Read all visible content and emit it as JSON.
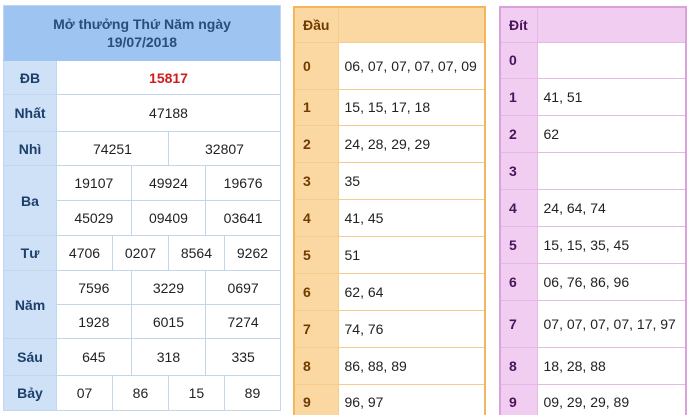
{
  "results": {
    "title_line1": "Mở thưởng Thứ Năm ngày",
    "title_line2": "19/07/2018",
    "special": {
      "label": "ĐB",
      "value": "15817"
    },
    "first": {
      "label": "Nhất",
      "value": "47188"
    },
    "second": {
      "label": "Nhì",
      "values": [
        "74251",
        "32807"
      ]
    },
    "third": {
      "label": "Ba",
      "values": [
        "19107",
        "49924",
        "19676",
        "45029",
        "09409",
        "03641"
      ]
    },
    "fourth": {
      "label": "Tư",
      "values": [
        "4706",
        "0207",
        "8564",
        "9262"
      ]
    },
    "fifth": {
      "label": "Năm",
      "values": [
        "7596",
        "3229",
        "0697",
        "1928",
        "6015",
        "7274"
      ]
    },
    "sixth": {
      "label": "Sáu",
      "values": [
        "645",
        "318",
        "335"
      ]
    },
    "seventh": {
      "label": "Bảy",
      "values": [
        "07",
        "86",
        "15",
        "89"
      ]
    }
  },
  "dau": {
    "header": "Đầu",
    "rows": [
      {
        "key": "0",
        "nums": "06, 07, 07, 07, 07, 09"
      },
      {
        "key": "1",
        "nums": "15, 15, 17, 18"
      },
      {
        "key": "2",
        "nums": "24, 28, 29, 29"
      },
      {
        "key": "3",
        "nums": "35"
      },
      {
        "key": "4",
        "nums": "41, 45"
      },
      {
        "key": "5",
        "nums": "51"
      },
      {
        "key": "6",
        "nums": "62, 64"
      },
      {
        "key": "7",
        "nums": "74, 76"
      },
      {
        "key": "8",
        "nums": "86, 88, 89"
      },
      {
        "key": "9",
        "nums": "96, 97"
      }
    ]
  },
  "dit": {
    "header": "Đít",
    "rows": [
      {
        "key": "0",
        "nums": ""
      },
      {
        "key": "1",
        "nums": "41, 51"
      },
      {
        "key": "2",
        "nums": "62"
      },
      {
        "key": "3",
        "nums": ""
      },
      {
        "key": "4",
        "nums": "24, 64, 74"
      },
      {
        "key": "5",
        "nums": "15, 15, 35, 45"
      },
      {
        "key": "6",
        "nums": "06, 76, 86, 96"
      },
      {
        "key": "7",
        "nums": "07, 07, 07, 07, 17, 97"
      },
      {
        "key": "8",
        "nums": "18, 28, 88"
      },
      {
        "key": "9",
        "nums": "09, 29, 29, 89"
      }
    ]
  },
  "colors": {
    "results_header": "#9ec5f2",
    "results_label": "#cfe1f7",
    "special_prize": "#d21c1c",
    "dau_accent": "#fbd7a1",
    "dit_accent": "#f2cdf2"
  }
}
